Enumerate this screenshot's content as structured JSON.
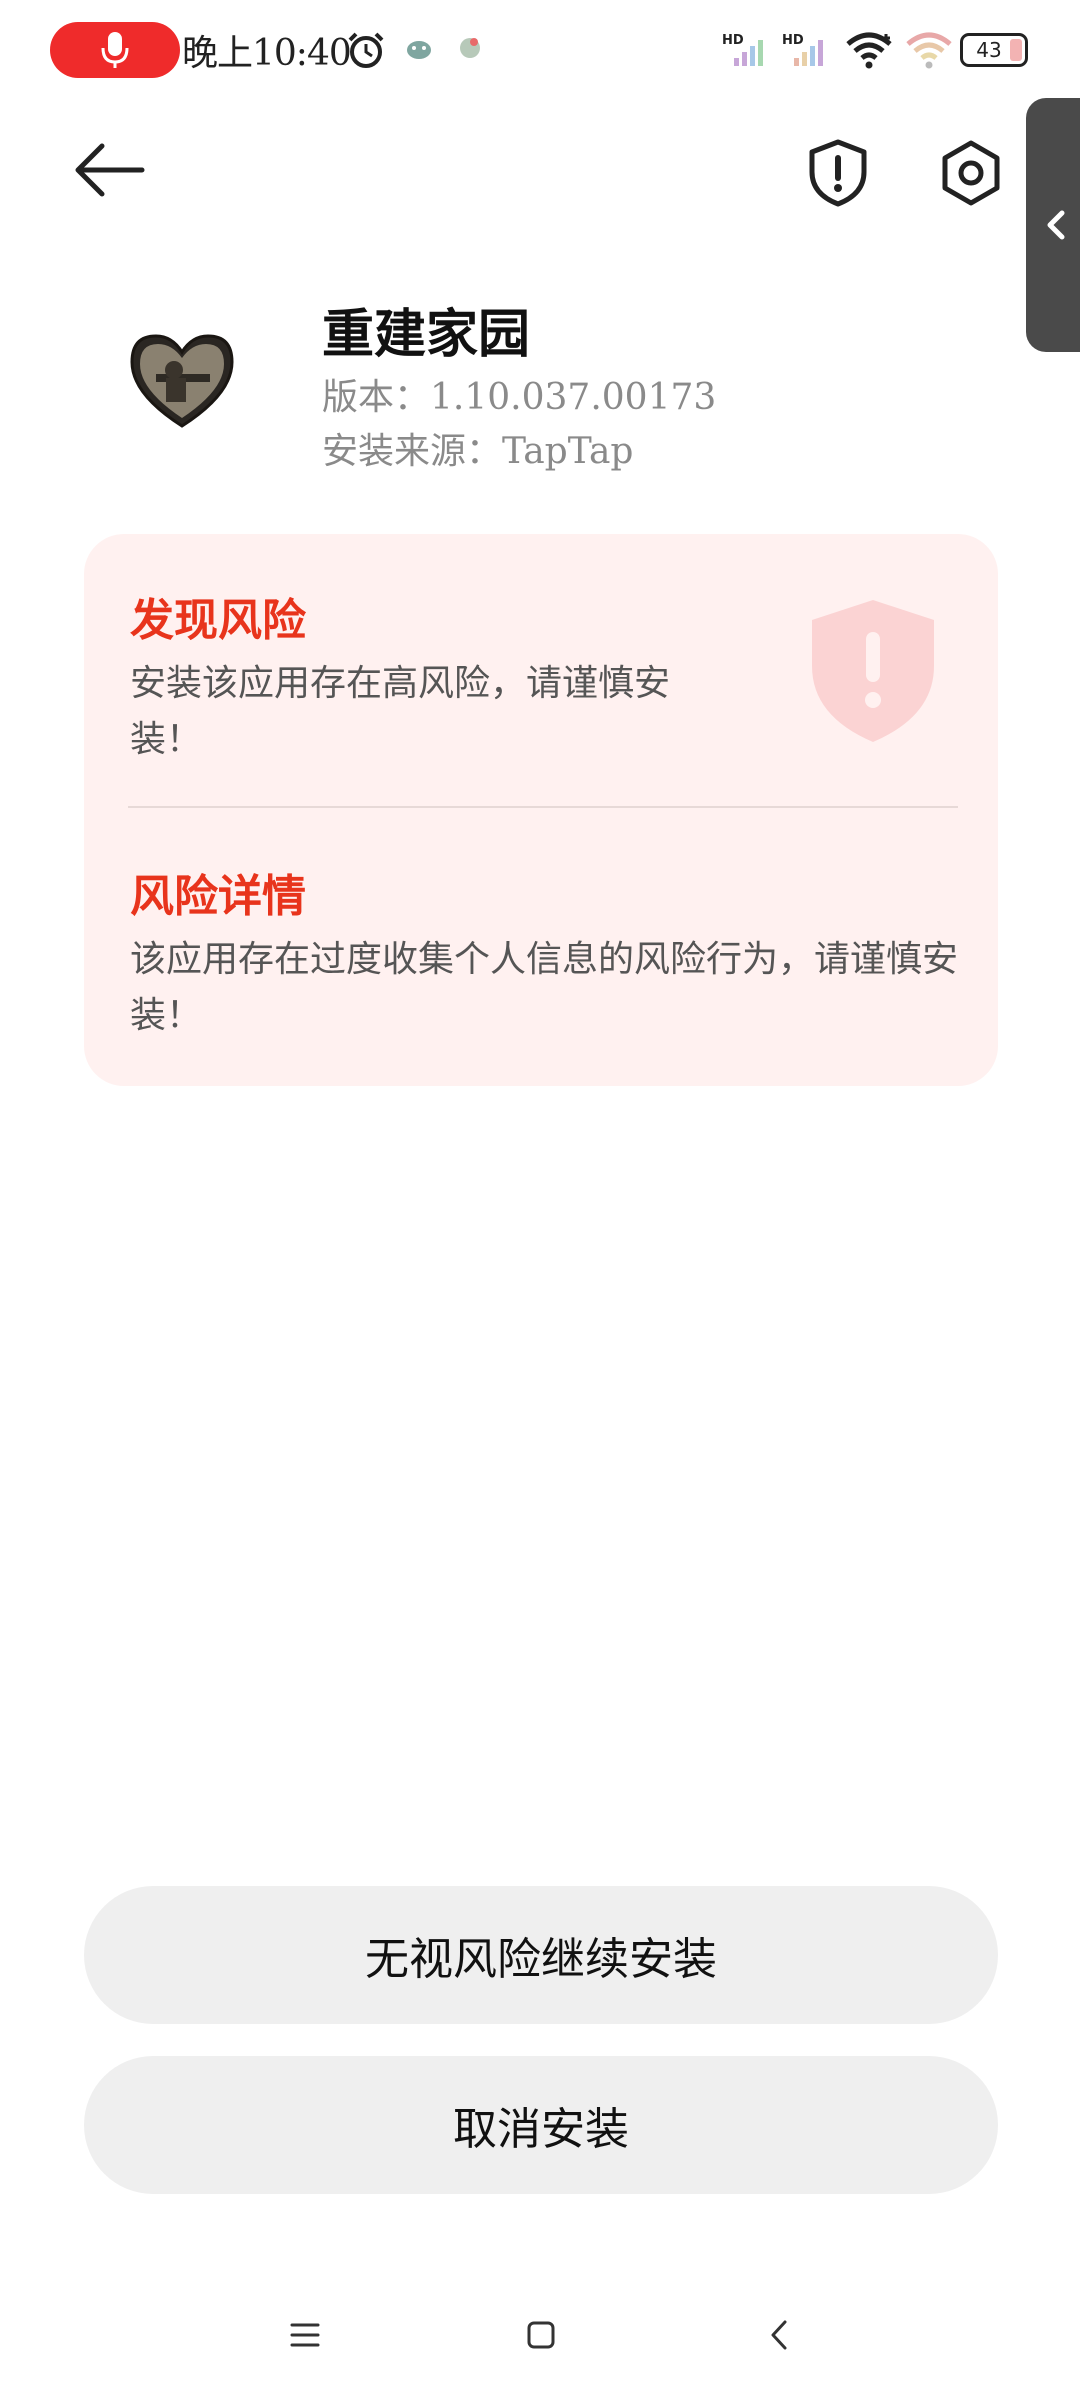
{
  "status_bar": {
    "time": "晚上10:40",
    "battery_level": "43",
    "icons": [
      "mic-icon",
      "alarm-icon",
      "notification-icon",
      "notification-icon",
      "signal-hd-icon",
      "signal-hd-icon",
      "wifi-icon",
      "wifi-icon",
      "battery-icon"
    ],
    "accent_color": "#ef2b2b"
  },
  "toolbar": {
    "icons": [
      "back-arrow-icon",
      "shield-alert-icon",
      "settings-icon",
      "chevron-left-icon"
    ]
  },
  "app": {
    "name": "重建家园",
    "version": "版本：1.10.037.00173",
    "source": "安装来源：TapTap"
  },
  "risk": {
    "found_title": "发现风险",
    "found_text": "安装该应用存在高风险，请谨慎安装！",
    "detail_title": "风险详情",
    "detail_text": "该应用存在过度收集个人信息的风险行为，请谨慎安装！",
    "title_color": "#e8341c",
    "card_color": "#fff1f0"
  },
  "actions": {
    "continue_label": "无视风险继续安装",
    "cancel_label": "取消安装"
  },
  "nav_bar": {
    "icons": [
      "menu-icon",
      "home-icon",
      "back-icon"
    ]
  }
}
